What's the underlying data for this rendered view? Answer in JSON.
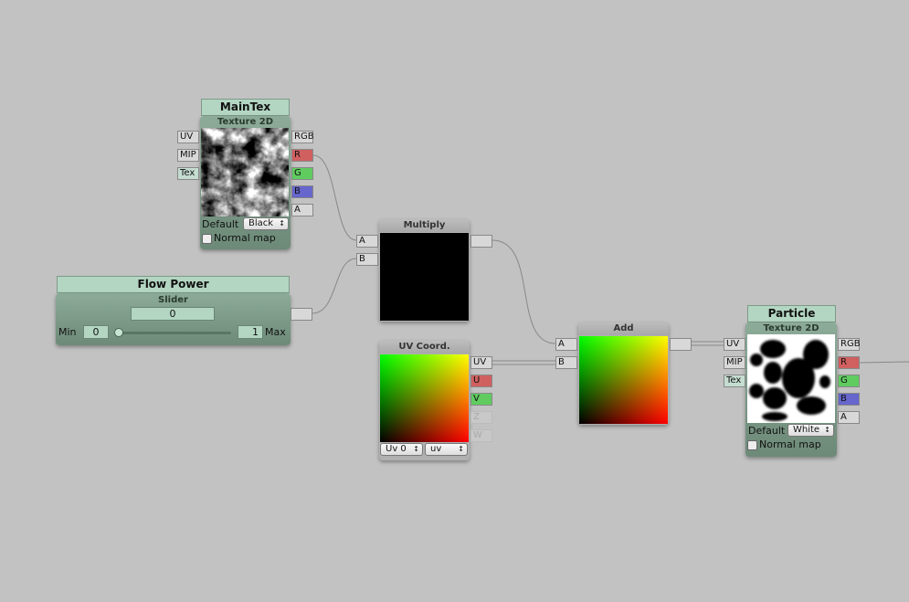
{
  "nodes": {
    "maintex": {
      "title": "MainTex",
      "type": "Texture 2D",
      "inputs": [
        "UV",
        "MIP",
        "Tex"
      ],
      "outputs": [
        "RGB",
        "R",
        "G",
        "B",
        "A"
      ],
      "default_label": "Default",
      "default_value": "Black",
      "normal_map": "Normal map"
    },
    "flow_power": {
      "title": "Flow Power",
      "type": "Slider",
      "value": "0",
      "min_label": "Min",
      "min": "0",
      "max": "1",
      "max_label": "Max",
      "slider_fraction": 0
    },
    "multiply": {
      "title": "Multiply",
      "inputs": [
        "A",
        "B"
      ]
    },
    "uv_coord": {
      "title": "UV Coord.",
      "outputs": [
        "UV",
        "U",
        "V",
        "Z",
        "W"
      ],
      "channel": "Uv 0",
      "mode": "uv"
    },
    "add": {
      "title": "Add",
      "inputs": [
        "A",
        "B"
      ]
    },
    "particle": {
      "title": "Particle",
      "type": "Texture 2D",
      "inputs": [
        "UV",
        "MIP",
        "Tex"
      ],
      "outputs": [
        "RGB",
        "R",
        "G",
        "B",
        "A"
      ],
      "default_label": "Default",
      "default_value": "White",
      "normal_map": "Normal map"
    }
  },
  "colors": {
    "canvas": "#c2c2c2",
    "r": "#d06060",
    "g": "#60cc60",
    "b": "#6666cc"
  }
}
